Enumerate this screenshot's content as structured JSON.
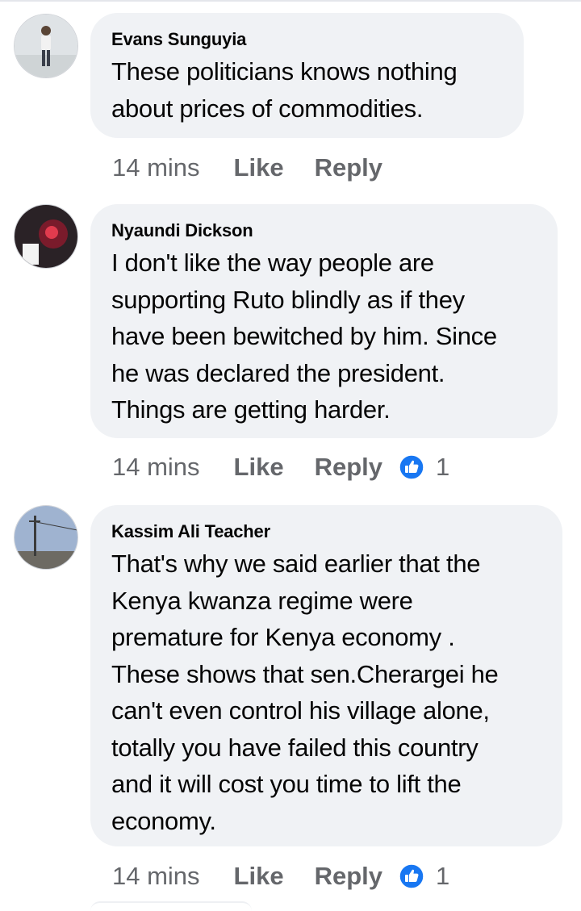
{
  "comments": [
    {
      "author": "Evans Sunguyia",
      "text": "These politicians knows nothing\nabout prices of commodities.",
      "time": "14 mins",
      "like_label": "Like",
      "reply_label": "Reply",
      "reactions": null,
      "avatar_icon": "avatar-man-standing"
    },
    {
      "author": "Nyaundi Dickson",
      "text": "I don't like the way people are\nsupporting Ruto blindly as if they\nhave been bewitched by him. Since\nhe was declared the president.\nThings are getting harder.",
      "time": "14 mins",
      "like_label": "Like",
      "reply_label": "Reply",
      "reactions": "1",
      "avatar_icon": "avatar-dark-red"
    },
    {
      "author": "Kassim Ali Teacher",
      "text": "That's why we said earlier that the\nKenya kwanza regime were\npremature for Kenya economy .\nThese shows that sen.Cherargei he\ncan't even control his village alone,\ntotally you have failed this country\nand it will cost you time to lift the\neconomy.",
      "time": "14 mins",
      "like_label": "Like",
      "reply_label": "Reply",
      "reactions": "1",
      "avatar_icon": "avatar-sky-pole"
    }
  ],
  "colors": {
    "bubble": "#f0f2f5",
    "meta_text": "#65676b",
    "like_reaction": "#1877f2"
  },
  "icons": {
    "reaction": "thumbs-up-icon"
  }
}
